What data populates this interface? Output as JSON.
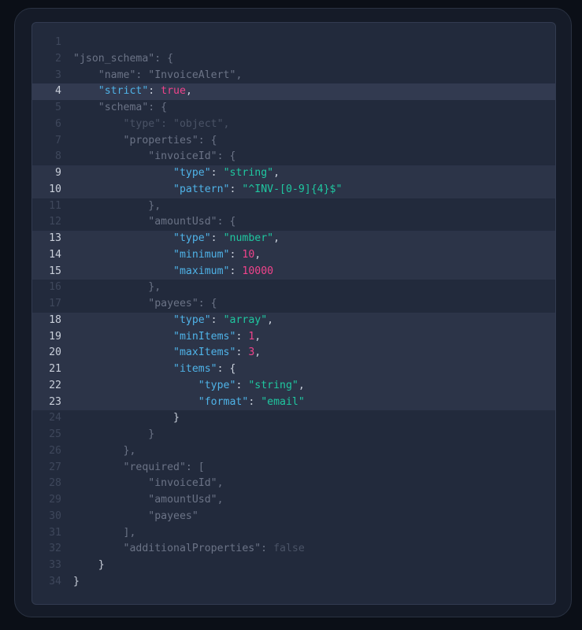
{
  "colors": {
    "key": "#4fb3e8",
    "string": "#1fc7a0",
    "number": "#f0438b",
    "dim_text": "#6b7386",
    "line_highlight": "#2c3448"
  },
  "code_lines": [
    {
      "n": "1",
      "hl": false,
      "tokens": []
    },
    {
      "n": "2",
      "hl": false,
      "tokens": [
        [
          "dim",
          "\"json_schema\""
        ],
        [
          "dim",
          ": {"
        ]
      ]
    },
    {
      "n": "3",
      "hl": false,
      "tokens": [
        [
          "dim",
          "    \"name\""
        ],
        [
          "dim",
          ": \"InvoiceAlert\","
        ]
      ]
    },
    {
      "n": "4",
      "hl": "strong",
      "tokens": [
        [
          "key",
          "    \"strict\""
        ],
        [
          "base",
          ": "
        ],
        [
          "kw",
          "true"
        ],
        [
          "base",
          ","
        ]
      ]
    },
    {
      "n": "5",
      "hl": false,
      "tokens": [
        [
          "dim",
          "    \"schema\": {"
        ]
      ]
    },
    {
      "n": "6",
      "hl": false,
      "tokens": [
        [
          "dimmer",
          "        \"type\": \"object\","
        ]
      ]
    },
    {
      "n": "7",
      "hl": false,
      "tokens": [
        [
          "dim",
          "        \"properties\": {"
        ]
      ]
    },
    {
      "n": "8",
      "hl": false,
      "tokens": [
        [
          "dim",
          "            \"invoiceId\": {"
        ]
      ]
    },
    {
      "n": "9",
      "hl": true,
      "tokens": [
        [
          "key",
          "                \"type\""
        ],
        [
          "base",
          ": "
        ],
        [
          "str",
          "\"string\""
        ],
        [
          "base",
          ","
        ]
      ]
    },
    {
      "n": "10",
      "hl": true,
      "tokens": [
        [
          "key",
          "                \"pattern\""
        ],
        [
          "base",
          ": "
        ],
        [
          "str",
          "\"^INV-[0-9]{4}$\""
        ]
      ]
    },
    {
      "n": "11",
      "hl": false,
      "tokens": [
        [
          "dim",
          "            },"
        ]
      ]
    },
    {
      "n": "12",
      "hl": false,
      "tokens": [
        [
          "dim",
          "            \"amountUsd\": {"
        ]
      ]
    },
    {
      "n": "13",
      "hl": true,
      "tokens": [
        [
          "key",
          "                \"type\""
        ],
        [
          "base",
          ": "
        ],
        [
          "str",
          "\"number\""
        ],
        [
          "base",
          ","
        ]
      ]
    },
    {
      "n": "14",
      "hl": true,
      "tokens": [
        [
          "key",
          "                \"minimum\""
        ],
        [
          "base",
          ": "
        ],
        [
          "num",
          "10"
        ],
        [
          "base",
          ","
        ]
      ]
    },
    {
      "n": "15",
      "hl": true,
      "tokens": [
        [
          "key",
          "                \"maximum\""
        ],
        [
          "base",
          ": "
        ],
        [
          "num",
          "10000"
        ]
      ]
    },
    {
      "n": "16",
      "hl": false,
      "tokens": [
        [
          "dim",
          "            },"
        ]
      ]
    },
    {
      "n": "17",
      "hl": false,
      "tokens": [
        [
          "dim",
          "            \"payees\": {"
        ]
      ]
    },
    {
      "n": "18",
      "hl": true,
      "tokens": [
        [
          "key",
          "                \"type\""
        ],
        [
          "base",
          ": "
        ],
        [
          "str",
          "\"array\""
        ],
        [
          "base",
          ","
        ]
      ]
    },
    {
      "n": "19",
      "hl": true,
      "tokens": [
        [
          "key",
          "                \"minItems\""
        ],
        [
          "base",
          ": "
        ],
        [
          "num",
          "1"
        ],
        [
          "base",
          ","
        ]
      ]
    },
    {
      "n": "20",
      "hl": true,
      "tokens": [
        [
          "key",
          "                \"maxItems\""
        ],
        [
          "base",
          ": "
        ],
        [
          "num",
          "3"
        ],
        [
          "base",
          ","
        ]
      ]
    },
    {
      "n": "21",
      "hl": true,
      "tokens": [
        [
          "key",
          "                \"items\""
        ],
        [
          "base",
          ": {"
        ]
      ]
    },
    {
      "n": "22",
      "hl": true,
      "tokens": [
        [
          "key",
          "                    \"type\""
        ],
        [
          "base",
          ": "
        ],
        [
          "str",
          "\"string\""
        ],
        [
          "base",
          ","
        ]
      ]
    },
    {
      "n": "23",
      "hl": true,
      "tokens": [
        [
          "key",
          "                    \"format\""
        ],
        [
          "base",
          ": "
        ],
        [
          "str",
          "\"email\""
        ]
      ]
    },
    {
      "n": "24",
      "hl": false,
      "tokens": [
        [
          "base",
          "                }"
        ]
      ]
    },
    {
      "n": "25",
      "hl": false,
      "tokens": [
        [
          "dim",
          "            }"
        ]
      ]
    },
    {
      "n": "26",
      "hl": false,
      "tokens": [
        [
          "dim",
          "        },"
        ]
      ]
    },
    {
      "n": "27",
      "hl": false,
      "tokens": [
        [
          "dim",
          "        \"required\": ["
        ]
      ]
    },
    {
      "n": "28",
      "hl": false,
      "tokens": [
        [
          "dim",
          "            \"invoiceId\","
        ]
      ]
    },
    {
      "n": "29",
      "hl": false,
      "tokens": [
        [
          "dim",
          "            \"amountUsd\","
        ]
      ]
    },
    {
      "n": "30",
      "hl": false,
      "tokens": [
        [
          "dim",
          "            \"payees\""
        ]
      ]
    },
    {
      "n": "31",
      "hl": false,
      "tokens": [
        [
          "dim",
          "        ],"
        ]
      ]
    },
    {
      "n": "32",
      "hl": false,
      "tokens": [
        [
          "dim",
          "        \"additionalProperties\": "
        ],
        [
          "dimmer",
          "false"
        ]
      ]
    },
    {
      "n": "33",
      "hl": false,
      "tokens": [
        [
          "base",
          "    }"
        ]
      ]
    },
    {
      "n": "34",
      "hl": false,
      "tokens": [
        [
          "base",
          "}"
        ]
      ]
    }
  ]
}
